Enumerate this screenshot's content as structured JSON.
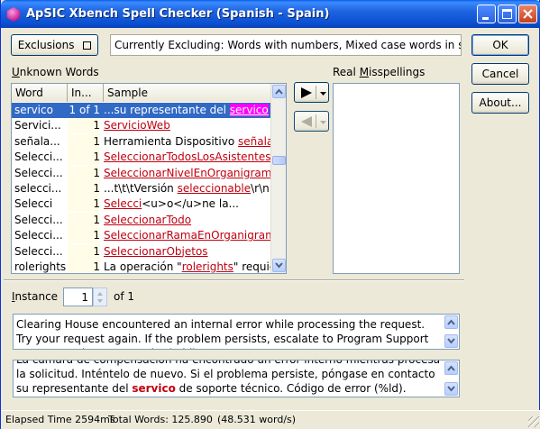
{
  "window": {
    "title": "ApSIC Xbench Spell Checker (Spanish - Spain)"
  },
  "toolbar": {
    "exclusions_label": "Exclusions",
    "exclusions_text": "Currently Excluding: Words with numbers, Mixed case words in sou"
  },
  "buttons": {
    "ok": "OK",
    "cancel": "Cancel",
    "about": "About..."
  },
  "labels": {
    "unknown_words_pre": "U",
    "unknown_words_rest": "nknown Words",
    "real_misspellings_pre": "Real ",
    "real_misspellings_u": "M",
    "real_misspellings_rest": "isspellings",
    "instance_pre": "I",
    "instance_rest": "nstance",
    "of_count": "of 1"
  },
  "instance_value": "1",
  "grid": {
    "headers": [
      "Word",
      "In...",
      "Sample"
    ],
    "rows": [
      {
        "word": "servico",
        "count": "1 of 1",
        "pre": "...su representante del ",
        "link": "servico",
        "post": " d",
        "selected": true
      },
      {
        "word": "Servici...",
        "count": "1",
        "pre": "",
        "link": "ServicioWeb",
        "post": ""
      },
      {
        "word": "señala...",
        "count": "1",
        "pre": "Herramienta Dispositivo ",
        "link": "señalado",
        "post": ""
      },
      {
        "word": "Selecci...",
        "count": "1",
        "pre": "",
        "link": "SeleccionarTodosLosAsistentesE",
        "post": ""
      },
      {
        "word": "Selecci...",
        "count": "1",
        "pre": "",
        "link": "SeleccionarNivelEnOrganigrama",
        "post": ""
      },
      {
        "word": "selecci...",
        "count": "1",
        "pre": "...t\\t\\tVersión ",
        "link": "seleccionable",
        "post": "\\r\\n..."
      },
      {
        "word": "Selecci",
        "count": "1",
        "pre": "",
        "link": "Selecci",
        "post": "<u>o</u>ne la..."
      },
      {
        "word": "Selecci...",
        "count": "1",
        "pre": "",
        "link": "SeleccionarTodo",
        "post": ""
      },
      {
        "word": "Selecci...",
        "count": "1",
        "pre": "",
        "link": "SeleccionarRamaEnOrganigrama",
        "post": ""
      },
      {
        "word": "Selecci...",
        "count": "1",
        "pre": "",
        "link": "SeleccionarObjetos",
        "post": ""
      },
      {
        "word": "rolerights",
        "count": "1",
        "pre": "La operación \"",
        "link": "rolerights",
        "post": "\" requier"
      }
    ]
  },
  "source_text": "Clearing House encountered an internal error while processing the request. Try your request again. If the problem persists, escalate to Program Support Representative. Error code: (%ld).",
  "target_text": {
    "line0": "La cámara de compensación ha encontrado un error interno mientras procesaba",
    "line1": "la solicitud. Inténtelo de  nuevo. Si el problema persiste, póngase en contacto con",
    "line2_pre": "su representante del ",
    "line2_bold": "servico",
    "line2_post": " de soporte técnico. Código de error (%ld)."
  },
  "status": {
    "elapsed": "Elapsed Time 2594ms",
    "total": "Total Words: 125.890",
    "rate": "(48.531 word/s)"
  },
  "colors": {
    "title_bar": "#0a4fd0",
    "selection": "#316ac5",
    "link": "#c0000f",
    "highlight": "#ff00ff"
  }
}
